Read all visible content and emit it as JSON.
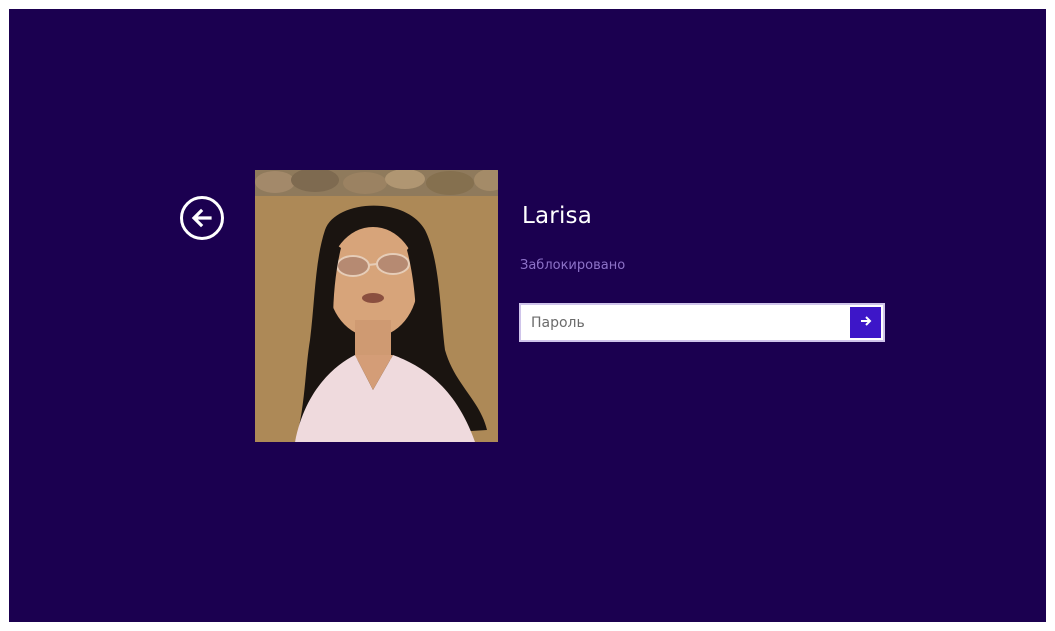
{
  "colors": {
    "background": "#1b0050",
    "status_text": "#8d72c8",
    "submit_button": "#3d16c8"
  },
  "icons": {
    "back": "back-arrow-circle-icon",
    "submit": "arrow-right-icon"
  },
  "user": {
    "name": "Larisa",
    "status": "Заблокировано"
  },
  "password": {
    "placeholder": "Пароль",
    "value": ""
  }
}
